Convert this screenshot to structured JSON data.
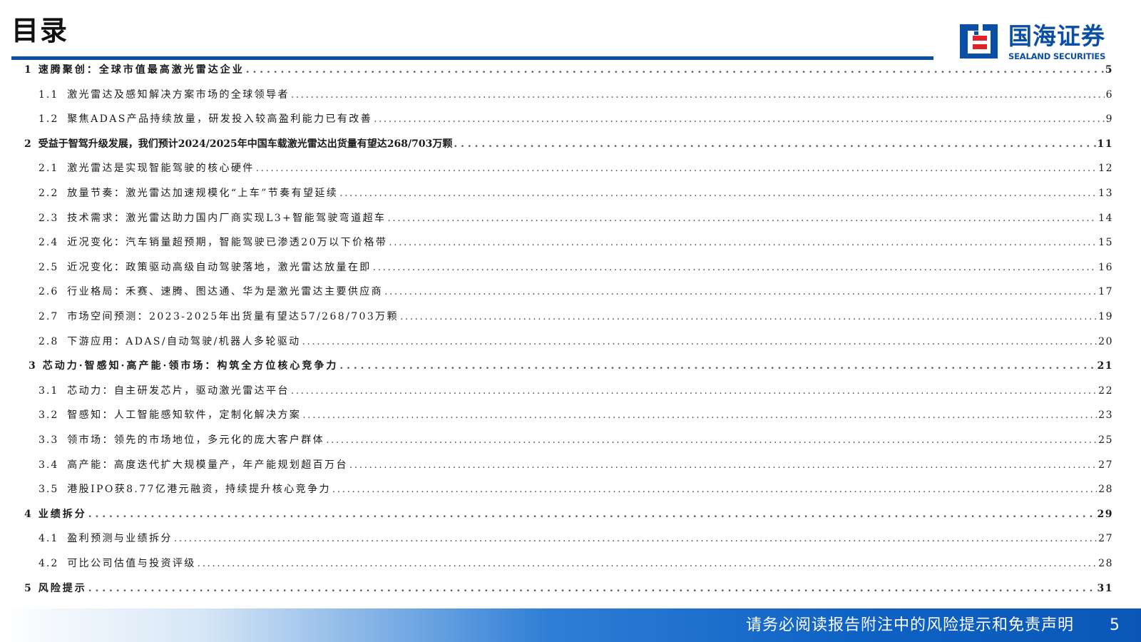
{
  "header": {
    "title": "目录",
    "logo_cn": "国海证券",
    "logo_en": "SEALAND SECURITIES",
    "brand_color": "#0a4fa6"
  },
  "toc": [
    {
      "level": 1,
      "num": "1",
      "text": "速腾聚创：全球市值最高激光雷达企业",
      "page": "5"
    },
    {
      "level": 2,
      "num": "1.1",
      "text": "激光雷达及感知解决方案市场的全球领导者",
      "page": "6"
    },
    {
      "level": 2,
      "num": "1.2",
      "text": "聚焦ADAS产品持续放量，研发投入较高盈利能力已有改善",
      "page": "9"
    },
    {
      "level": 1,
      "num": "2",
      "text": "受益于智驾升级发展，我们预计2024/2025年中国车载激光雷达出货量有望达268/703万颗",
      "page": "11"
    },
    {
      "level": 2,
      "num": "2.1",
      "text": "激光雷达是实现智能驾驶的核心硬件",
      "page": "12"
    },
    {
      "level": 2,
      "num": "2.2",
      "text": "放量节奏：激光雷达加速规模化“上车”节奏有望延续",
      "page": "13"
    },
    {
      "level": 2,
      "num": "2.3",
      "text": "技术需求：激光雷达助力国内厂商实现L3+智能驾驶弯道超车",
      "page": "14"
    },
    {
      "level": 2,
      "num": "2.4",
      "text": "近况变化：汽车销量超预期，智能驾驶已渗透20万以下价格带",
      "page": "15"
    },
    {
      "level": 2,
      "num": "2.5",
      "text": "近况变化：政策驱动高级自动驾驶落地，激光雷达放量在即",
      "page": "16"
    },
    {
      "level": 2,
      "num": "2.6",
      "text": "行业格局：禾赛、速腾、图达通、华为是激光雷达主要供应商",
      "page": "17"
    },
    {
      "level": 2,
      "num": "2.7",
      "text": "市场空间预测：2023-2025年出货量有望达57/268/703万颗",
      "page": "19"
    },
    {
      "level": 2,
      "num": "2.8",
      "text": "下游应用：ADAS/自动驾驶/机器人多轮驱动",
      "page": "20"
    },
    {
      "level": 1,
      "num": "3",
      "text": "芯动力·智感知·高产能·领市场：构筑全方位核心竞争力",
      "page": "21"
    },
    {
      "level": 2,
      "num": "3.1",
      "text": "芯动力：自主研发芯片，驱动激光雷达平台",
      "page": "22"
    },
    {
      "level": 2,
      "num": "3.2",
      "text": "智感知：人工智能感知软件，定制化解决方案",
      "page": "23"
    },
    {
      "level": 2,
      "num": "3.3",
      "text": "领市场：领先的市场地位，多元化的庞大客户群体",
      "page": "25"
    },
    {
      "level": 2,
      "num": "3.4",
      "text": "高产能：高度迭代扩大规模量产，年产能规划超百万台",
      "page": "27"
    },
    {
      "level": 2,
      "num": "3.5",
      "text": "港股IPO获8.77亿港元融资，持续提升核心竞争力",
      "page": "28"
    },
    {
      "level": 1,
      "num": "4",
      "text": "业绩拆分",
      "page": "29"
    },
    {
      "level": 2,
      "num": "4.1",
      "text": "盈利预测与业绩拆分",
      "page": "27"
    },
    {
      "level": 2,
      "num": "4.2",
      "text": "可比公司估值与投资评级",
      "page": "28"
    },
    {
      "level": 1,
      "num": "5",
      "text": "风险提示",
      "page": "31"
    }
  ],
  "footer": {
    "disclaimer": "请务必阅读报告附注中的风险提示和免责声明",
    "page_number": "5"
  }
}
